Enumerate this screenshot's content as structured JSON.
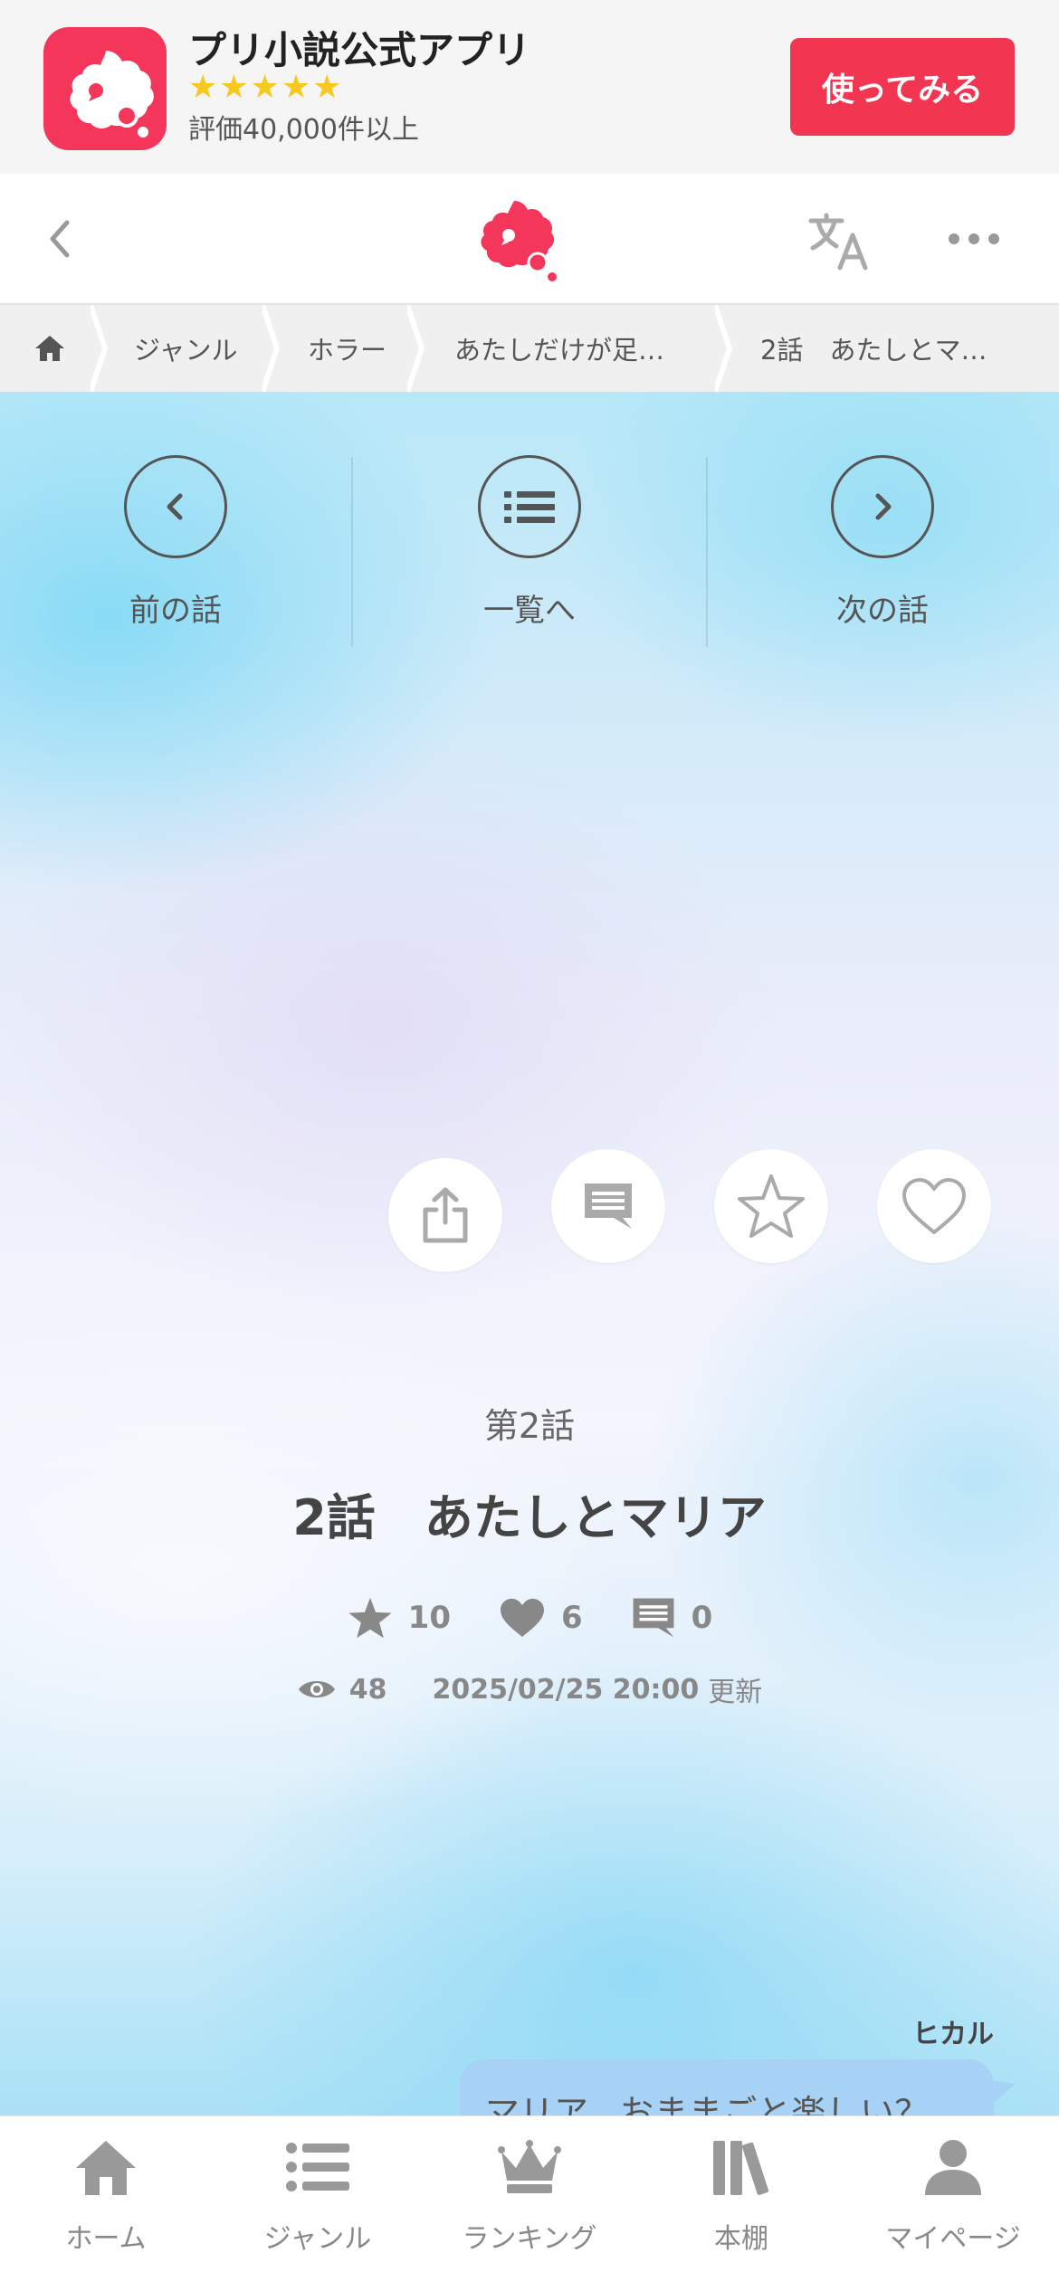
{
  "app_banner": {
    "title": "プリ小説公式アプリ",
    "stars": "★★★★★",
    "rating_text": "評価40,000件以上",
    "cta_label": "使ってみる",
    "accent_color": "#f23652"
  },
  "header": {
    "back_icon": "chevron-left-icon",
    "logo_icon": "prisho-logo-icon",
    "translate_icon": "translate-icon",
    "more_icon": "more-dots-icon"
  },
  "breadcrumb": {
    "home_icon": "home-icon",
    "items": [
      {
        "label": "ジャンル"
      },
      {
        "label": "ホラー"
      },
      {
        "label": "あたしだけが足…"
      },
      {
        "label": "2話　あたしとマ…"
      }
    ]
  },
  "episode_nav": {
    "prev_label": "前の話",
    "list_label": "一覧へ",
    "next_label": "次の話"
  },
  "actions": {
    "share_icon": "share-icon",
    "comment_icon": "comment-icon",
    "star_icon": "star-outline-icon",
    "heart_icon": "heart-outline-icon"
  },
  "episode": {
    "number": "第2話",
    "title": "2話　あたしとマリア",
    "stars": "10",
    "likes": "6",
    "comments": "0",
    "views": "48",
    "date": "2025/02/25 20:00",
    "updated_label": "更新"
  },
  "chat": {
    "speaker": "ヒカル",
    "message": "マリア、おままごと楽しい？"
  },
  "tabbar": {
    "items": [
      {
        "label": "ホーム",
        "icon": "home-icon"
      },
      {
        "label": "ジャンル",
        "icon": "list-icon"
      },
      {
        "label": "ランキング",
        "icon": "crown-icon"
      },
      {
        "label": "本棚",
        "icon": "bookshelf-icon"
      },
      {
        "label": "マイページ",
        "icon": "person-icon"
      }
    ]
  }
}
